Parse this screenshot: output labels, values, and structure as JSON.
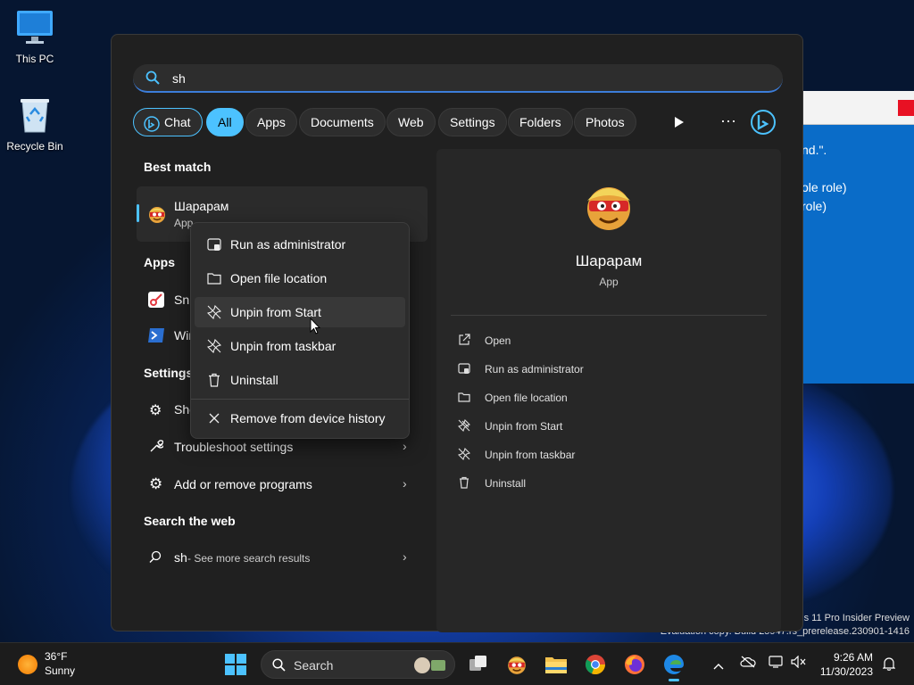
{
  "desktop": {
    "icons": [
      {
        "label": "This PC"
      },
      {
        "label": "Recycle Bin"
      }
    ],
    "watermark": [
      "s 11 Pro Insider Preview",
      "Evaluation copy. Build 25947.rs_prerelease.230901-1416"
    ],
    "bg_window_lines": [
      "nd.\".",
      "",
      "ole role)",
      "role)"
    ]
  },
  "search": {
    "query": "sh",
    "icon": "search-icon"
  },
  "filters": [
    "Chat",
    "All",
    "Apps",
    "Documents",
    "Web",
    "Settings",
    "Folders",
    "Photos"
  ],
  "filters_selected": "All",
  "sections": {
    "best_match": "Best match",
    "apps": "Apps",
    "settings": "Settings",
    "search_web": "Search the web"
  },
  "best_match": {
    "name": "Шарарам",
    "type": "App"
  },
  "apps": [
    {
      "name": "Snipping Tool",
      "visible": "Sni"
    },
    {
      "name": "Windows PowerShell",
      "visible": "Win"
    }
  ],
  "settings_items": [
    {
      "label": "Sho"
    },
    {
      "label": "Troubleshoot settings"
    },
    {
      "label": "Add or remove programs"
    }
  ],
  "web": {
    "query": "sh",
    "suffix": " - See more search results"
  },
  "detail": {
    "name": "Шарарам",
    "type": "App",
    "actions": [
      "Open",
      "Run as administrator",
      "Open file location",
      "Unpin from Start",
      "Unpin from taskbar",
      "Uninstall"
    ]
  },
  "context_menu": {
    "items": [
      "Run as administrator",
      "Open file location",
      "Unpin from Start",
      "Unpin from taskbar",
      "Uninstall"
    ],
    "history": "Remove from device history",
    "hovered": "Unpin from Start"
  },
  "taskbar": {
    "weather": {
      "temp": "36°F",
      "cond": "Sunny"
    },
    "search_placeholder": "Search",
    "time": "9:26 AM",
    "date": "11/30/2023"
  },
  "colors": {
    "accent": "#4cc2ff",
    "panel": "#202020"
  }
}
